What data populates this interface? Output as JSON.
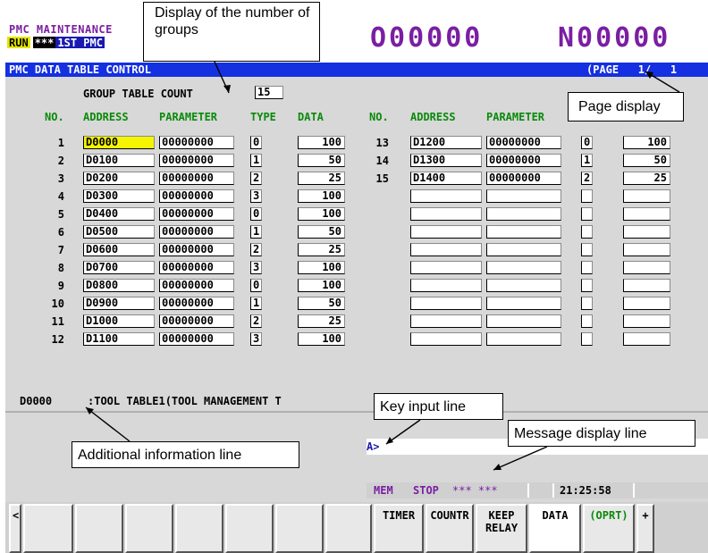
{
  "header": {
    "mode_title": "PMC MAINTENANCE",
    "run_state": "RUN",
    "stars": "***",
    "pmc_name": "1ST PMC",
    "program_number": "O00000",
    "sequence_number": "N00000"
  },
  "title_bar": {
    "screen_title": "PMC DATA TABLE CONTROL",
    "page": "(PAGE   1/   1"
  },
  "group_count": {
    "label": "GROUP TABLE COUNT",
    "value": "15"
  },
  "columns": [
    "NO.",
    "ADDRESS",
    "PARAMETER",
    "TYPE",
    "DATA"
  ],
  "rows_left": [
    {
      "no": "1",
      "address": "D0000",
      "parameter": "00000000",
      "type": "0",
      "data": "100"
    },
    {
      "no": "2",
      "address": "D0100",
      "parameter": "00000000",
      "type": "1",
      "data": "50"
    },
    {
      "no": "3",
      "address": "D0200",
      "parameter": "00000000",
      "type": "2",
      "data": "25"
    },
    {
      "no": "4",
      "address": "D0300",
      "parameter": "00000000",
      "type": "3",
      "data": "100"
    },
    {
      "no": "5",
      "address": "D0400",
      "parameter": "00000000",
      "type": "0",
      "data": "100"
    },
    {
      "no": "6",
      "address": "D0500",
      "parameter": "00000000",
      "type": "1",
      "data": "50"
    },
    {
      "no": "7",
      "address": "D0600",
      "parameter": "00000000",
      "type": "2",
      "data": "25"
    },
    {
      "no": "8",
      "address": "D0700",
      "parameter": "00000000",
      "type": "3",
      "data": "100"
    },
    {
      "no": "9",
      "address": "D0800",
      "parameter": "00000000",
      "type": "0",
      "data": "100"
    },
    {
      "no": "10",
      "address": "D0900",
      "parameter": "00000000",
      "type": "1",
      "data": "50"
    },
    {
      "no": "11",
      "address": "D1000",
      "parameter": "00000000",
      "type": "2",
      "data": "25"
    },
    {
      "no": "12",
      "address": "D1100",
      "parameter": "00000000",
      "type": "3",
      "data": "100"
    }
  ],
  "rows_right": [
    {
      "no": "13",
      "address": "D1200",
      "parameter": "00000000",
      "type": "0",
      "data": "100"
    },
    {
      "no": "14",
      "address": "D1300",
      "parameter": "00000000",
      "type": "1",
      "data": "50"
    },
    {
      "no": "15",
      "address": "D1400",
      "parameter": "00000000",
      "type": "2",
      "data": "25"
    },
    {
      "no": "",
      "address": "",
      "parameter": "",
      "type": "",
      "data": ""
    },
    {
      "no": "",
      "address": "",
      "parameter": "",
      "type": "",
      "data": ""
    },
    {
      "no": "",
      "address": "",
      "parameter": "",
      "type": "",
      "data": ""
    },
    {
      "no": "",
      "address": "",
      "parameter": "",
      "type": "",
      "data": ""
    },
    {
      "no": "",
      "address": "",
      "parameter": "",
      "type": "",
      "data": ""
    },
    {
      "no": "",
      "address": "",
      "parameter": "",
      "type": "",
      "data": ""
    },
    {
      "no": "",
      "address": "",
      "parameter": "",
      "type": "",
      "data": ""
    },
    {
      "no": "",
      "address": "",
      "parameter": "",
      "type": "",
      "data": ""
    },
    {
      "no": "",
      "address": "",
      "parameter": "",
      "type": "",
      "data": ""
    }
  ],
  "info_line": {
    "address": "D0000",
    "text": ":TOOL TABLE1(TOOL MANAGEMENT T"
  },
  "key_input": {
    "prompt": "A>",
    "value": ""
  },
  "status": {
    "mode": "MEM",
    "state": "STOP",
    "alarm": "*** ***",
    "time": "21:25:58"
  },
  "softkeys": {
    "back": "<",
    "timer": "TIMER",
    "counter": "COUNTR",
    "keep_relay": "KEEP RELAY",
    "data": "DATA",
    "oprt": "(OPRT)",
    "next": "+"
  },
  "callouts": {
    "groups": "Display of the number of groups",
    "page": "Page display",
    "key_input": "Key input line",
    "message": "Message display line",
    "additional": "Additional information line"
  },
  "colors": {
    "title_bar": "#1430e0",
    "column_header": "#0a8a0a",
    "header_text": "#7a1fa2",
    "highlight": "#f5f500"
  }
}
